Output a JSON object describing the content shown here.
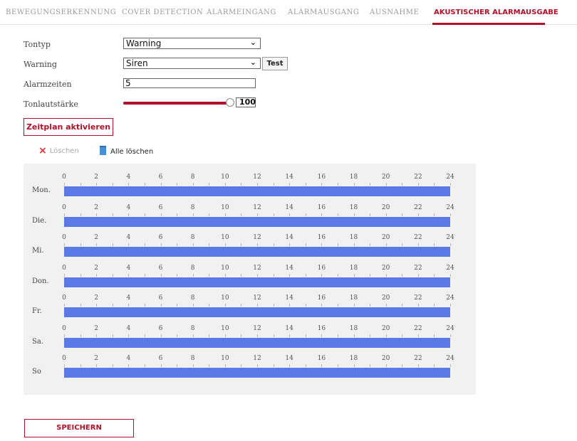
{
  "tabs": [
    {
      "label": "BEWEGUNGSERKENNUNG",
      "active": false
    },
    {
      "label": "COVER DETECTION",
      "active": false
    },
    {
      "label": "ALARMEINGANG",
      "active": false
    },
    {
      "label": "ALARMAUSGANG",
      "active": false
    },
    {
      "label": "AUSNAHME",
      "active": false
    },
    {
      "label": "AKUSTISCHER ALARMAUSGABE",
      "active": true
    }
  ],
  "form": {
    "tontyp_label": "Tontyp",
    "tontyp_value": "Warning",
    "warning_label": "Warning",
    "warning_value": "Siren",
    "test_label": "Test",
    "alarmzeiten_label": "Alarmzeiten",
    "alarmzeiten_value": "5",
    "lautstaerke_label": "Tonlautstärke",
    "lautstaerke_value": "100",
    "lautstaerke_level": 1.0
  },
  "schedule_button": "Zeitplan aktivieren",
  "toolbar": {
    "delete_label": "Löschen",
    "delete_all_label": "Alle löschen"
  },
  "schedule": {
    "hour_ticks": [
      "0",
      "2",
      "4",
      "6",
      "8",
      "10",
      "12",
      "14",
      "16",
      "18",
      "20",
      "22",
      "24"
    ],
    "days": [
      {
        "label": "Mon."
      },
      {
        "label": "Die."
      },
      {
        "label": "Mi."
      },
      {
        "label": "Don."
      },
      {
        "label": "Fr."
      },
      {
        "label": "Sa."
      },
      {
        "label": "So"
      }
    ],
    "bar_color": "#5b79e6"
  },
  "save_label": "SPEICHERN",
  "colors": {
    "accent": "#b3102a"
  }
}
